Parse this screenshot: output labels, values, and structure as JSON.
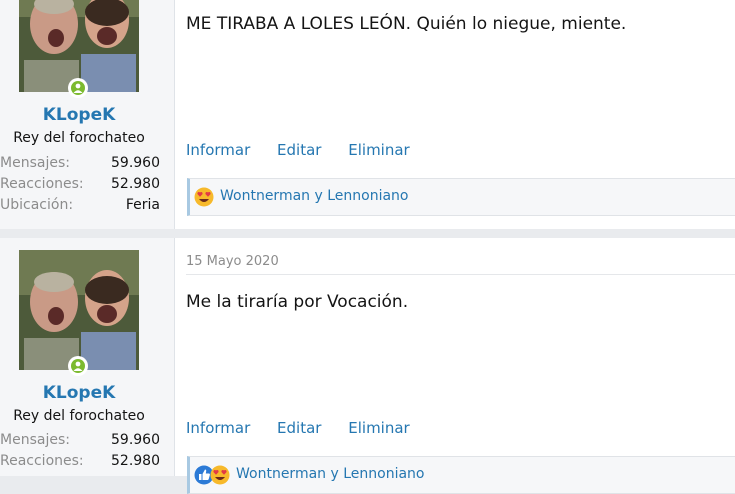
{
  "posts": [
    {
      "author": {
        "username": "KLopeK",
        "title": "Rey del forochateo",
        "stats": [
          {
            "label": "Mensajes:",
            "value": "59.960"
          },
          {
            "label": "Reacciones:",
            "value": "52.980"
          },
          {
            "label": "Ubicación:",
            "value": "Feria"
          }
        ]
      },
      "date": "",
      "message": "ME TIRABA A LOLES LEÓN. Quién lo niegue, miente.",
      "actions": [
        "Informar",
        "Editar",
        "Eliminar"
      ],
      "reactions": {
        "icons": [
          "heart-eyes-emoji-icon"
        ],
        "text": "Wontnerman y Lennoniano"
      }
    },
    {
      "author": {
        "username": "KLopeK",
        "title": "Rey del forochateo",
        "stats": [
          {
            "label": "Mensajes:",
            "value": "59.960"
          },
          {
            "label": "Reacciones:",
            "value": "52.980"
          }
        ]
      },
      "date": "15 Mayo 2020",
      "message": "Me la tiraría por Vocación.",
      "actions": [
        "Informar",
        "Editar",
        "Eliminar"
      ],
      "reactions": {
        "icons": [
          "like-thumb-icon",
          "heart-eyes-emoji-icon"
        ],
        "text": "Wontnerman y Lennoniano"
      }
    }
  ],
  "colors": {
    "link": "#2577b1",
    "online": "#7cba2f",
    "muted": "#8c8c8c"
  }
}
